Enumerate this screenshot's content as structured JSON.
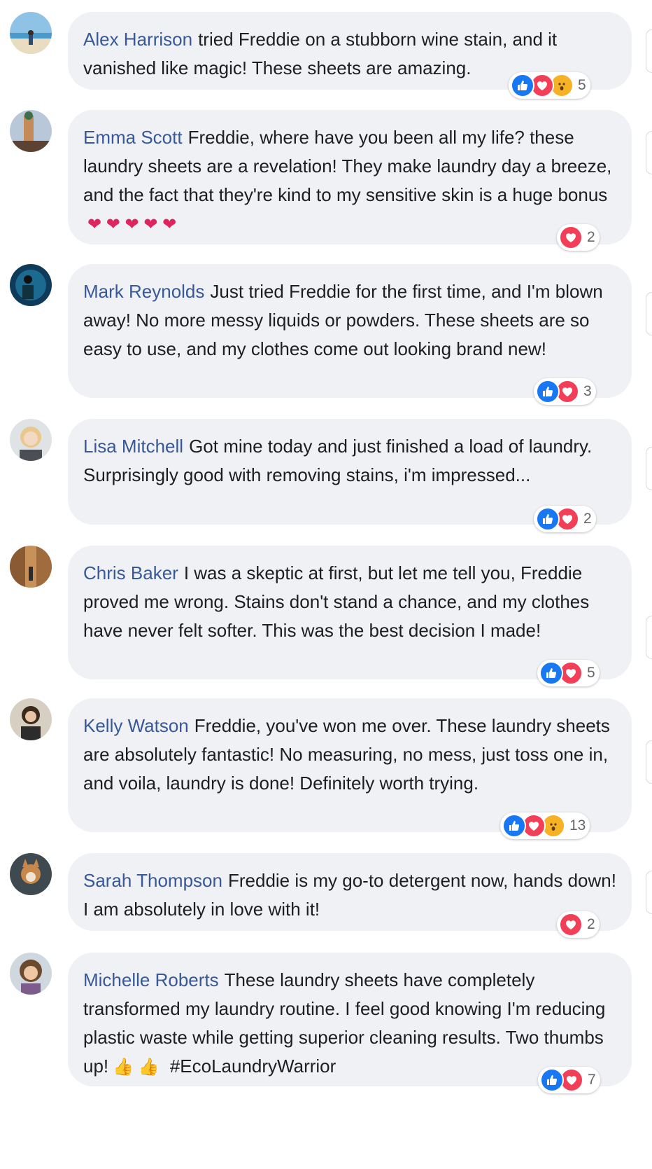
{
  "colors": {
    "author": "#385898",
    "bubble": "#eff1f4",
    "like": "#1877f2",
    "love": "#f33e58",
    "wow": "#f7b125"
  },
  "comments": [
    {
      "author": "Alex Harrison",
      "text": "tried Freddie on a stubborn wine stain, and it vanished like magic! These sheets are amazing.",
      "count": "5",
      "reactions": [
        "like-icon",
        "love-icon",
        "wow-icon"
      ]
    },
    {
      "author": "Emma Scott",
      "text": "Freddie, where have you been all my life? these laundry sheets are a revelation! They make laundry day a breeze, and the fact that they're kind to my sensitive skin is a huge bonus",
      "emoji": "❤ ❤ ❤ ❤ ❤",
      "count": "2",
      "reactions": [
        "love-icon"
      ]
    },
    {
      "author": "Mark Reynolds",
      "text": "Just tried Freddie for the first time, and I'm blown away! No more messy liquids or powders. These sheets are so easy to use, and my clothes come out looking brand new!",
      "count": "3",
      "reactions": [
        "like-icon",
        "love-icon"
      ]
    },
    {
      "author": "Lisa Mitchell",
      "text": "Got mine today and just finished a load of laundry. Surprisingly good with removing stains, i'm impressed...",
      "count": "2",
      "reactions": [
        "like-icon",
        "love-icon"
      ]
    },
    {
      "author": "Chris Baker",
      "text": "I was a skeptic at first, but let me tell you, Freddie proved me wrong. Stains don't stand a chance, and my clothes have never felt softer. This was the best decision I made!",
      "count": "5",
      "reactions": [
        "like-icon",
        "love-icon"
      ]
    },
    {
      "author": "Kelly Watson",
      "text": "Freddie, you've won me over. These laundry sheets are absolutely fantastic! No measuring, no mess, just toss one in, and voila, laundry is done! Definitely worth trying.",
      "count": "13",
      "reactions": [
        "like-icon",
        "love-icon",
        "wow-icon"
      ]
    },
    {
      "author": "Sarah Thompson",
      "text": "Freddie is my go-to detergent now, hands down! I am absolutely in love with it!",
      "count": "2",
      "reactions": [
        "love-icon"
      ]
    },
    {
      "author": "Michelle Roberts",
      "text": "These laundry sheets have completely transformed my laundry routine. I feel good knowing I'm reducing plastic waste while getting superior cleaning results. Two thumbs up!",
      "emoji": "👍 👍",
      "hashtag": "#EcoLaundryWarrior",
      "count": "7",
      "reactions": [
        "like-icon",
        "love-icon"
      ]
    }
  ]
}
